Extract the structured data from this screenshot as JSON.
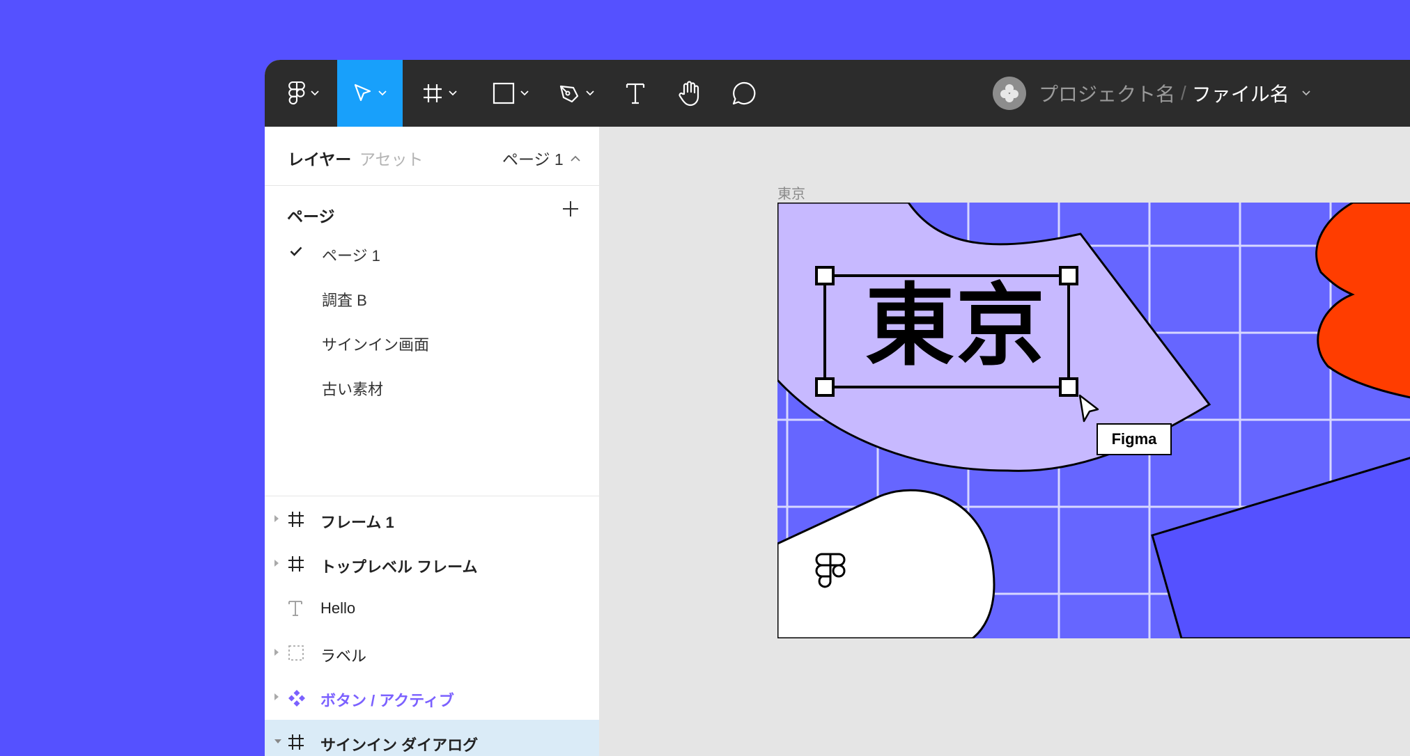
{
  "toolbar": {
    "tools": [
      {
        "name": "figma-menu",
        "icon": "figma-logo-icon"
      },
      {
        "name": "move",
        "icon": "cursor-arrow-icon",
        "active": true
      },
      {
        "name": "frame",
        "icon": "frame-hash-icon"
      },
      {
        "name": "shape",
        "icon": "rectangle-icon"
      },
      {
        "name": "pen",
        "icon": "pen-icon"
      },
      {
        "name": "text",
        "icon": "text-icon"
      },
      {
        "name": "hand",
        "icon": "hand-icon"
      },
      {
        "name": "comment",
        "icon": "speech-bubble-icon"
      }
    ],
    "active_color": "#18a0fb",
    "background": "#2c2c2c"
  },
  "breadcrumb": {
    "project": "プロジェクト名",
    "separator": "/",
    "file": "ファイル名"
  },
  "sidebar": {
    "tab_layers": "レイヤー",
    "tab_assets": "アセット",
    "current_page": "ページ 1",
    "pages_heading": "ページ",
    "pages": [
      {
        "label": "ページ 1",
        "selected": true
      },
      {
        "label": "調査 B"
      },
      {
        "label": "サインイン画面"
      },
      {
        "label": "古い素材"
      }
    ],
    "layers": [
      {
        "label": "フレーム 1",
        "icon": "frame-hash-icon",
        "style": "bold"
      },
      {
        "label": "トップレベル フレーム",
        "icon": "frame-hash-icon",
        "style": "bold"
      },
      {
        "label": "Hello",
        "icon": "text-icon",
        "style": "normal"
      },
      {
        "label": "ラベル",
        "icon": "dashed-frame-icon",
        "style": "normal"
      },
      {
        "label": "ボタン / アクティブ",
        "icon": "component-icon",
        "style": "component"
      },
      {
        "label": "サインイン ダイアログ",
        "icon": "frame-hash-icon",
        "style": "bold",
        "selected": true
      }
    ],
    "component_color": "#7b61ff",
    "selected_row_color": "#daebf7"
  },
  "canvas": {
    "frame_label": "東京",
    "selected_text": "東京",
    "cursor_badge": "Figma",
    "background": "#e5e5e5",
    "frame_bg": "#6666ff",
    "accent_red": "#ff3d00",
    "accent_lavender": "#c7b9ff"
  }
}
